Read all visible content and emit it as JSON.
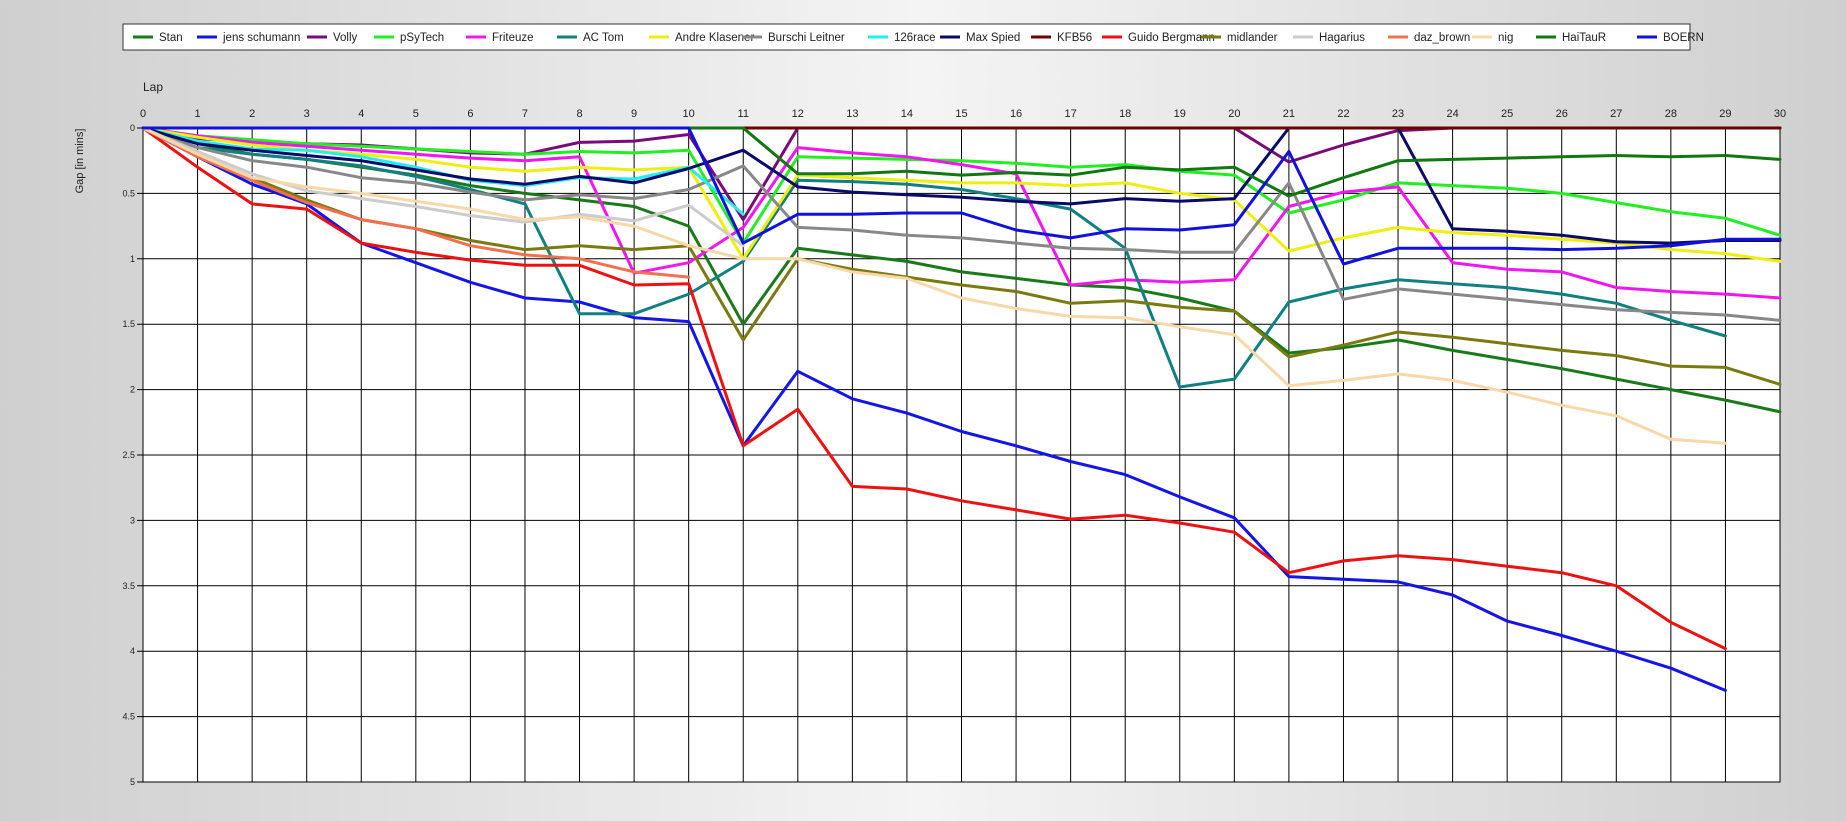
{
  "chart_data": {
    "type": "line",
    "xlabel": "Lap",
    "ylabel": "Gap [in mins]",
    "x": [
      0,
      1,
      2,
      3,
      4,
      5,
      6,
      7,
      8,
      9,
      10,
      11,
      12,
      13,
      14,
      15,
      16,
      17,
      18,
      19,
      20,
      21,
      22,
      23,
      24,
      25,
      26,
      27,
      28,
      29,
      30
    ],
    "xlim": [
      0,
      30
    ],
    "ylim": [
      0,
      5
    ],
    "y_inverted": true,
    "y_ticks": [
      "0",
      "0.5",
      "1",
      "1.5",
      "2",
      "2.5",
      "3",
      "3.5",
      "4",
      "4.5",
      "5"
    ],
    "grid": true,
    "legend_position": "top",
    "series": [
      {
        "name": "Stan",
        "color": "#1a7a1a",
        "values": [
          0,
          0.12,
          0.2,
          0.24,
          0.3,
          0.36,
          0.44,
          0.5,
          0.55,
          0.6,
          0.75,
          1.5,
          0.92,
          0.97,
          1.02,
          1.1,
          1.15,
          1.2,
          1.22,
          1.3,
          1.4,
          1.72,
          1.68,
          1.62,
          1.7,
          1.77,
          1.84,
          1.92,
          2.0,
          2.08,
          2.17
        ]
      },
      {
        "name": "jens  schumann",
        "color": "#1515e8",
        "values": [
          0,
          0.22,
          0.43,
          0.58,
          0.88,
          1.03,
          1.18,
          1.3,
          1.33,
          1.45,
          1.48,
          2.43,
          1.86,
          2.07,
          2.18,
          2.32,
          2.43,
          2.55,
          2.65,
          2.82,
          2.98,
          3.43,
          3.45,
          3.47,
          3.57,
          3.77,
          3.88,
          4.0,
          4.13,
          4.3,
          null
        ]
      },
      {
        "name": "Volly",
        "color": "#7a0a7a",
        "values": [
          0,
          0.08,
          0.11,
          0.12,
          0.13,
          0.16,
          0.19,
          0.2,
          0.11,
          0.1,
          0.05,
          0.7,
          0,
          0,
          0,
          0,
          0,
          0,
          0,
          0,
          0,
          0.26,
          0.13,
          0.02,
          0,
          0,
          0,
          0,
          0,
          0,
          0
        ]
      },
      {
        "name": "pSyTech",
        "color": "#22ee22",
        "values": [
          0,
          0.06,
          0.09,
          0.12,
          0.14,
          0.16,
          0.18,
          0.2,
          0.18,
          0.19,
          0.17,
          0.88,
          0.22,
          0.23,
          0.24,
          0.25,
          0.27,
          0.3,
          0.28,
          0.33,
          0.36,
          0.65,
          0.55,
          0.42,
          0.44,
          0.46,
          0.5,
          0.57,
          0.64,
          0.69,
          0.82
        ]
      },
      {
        "name": "Friteuze",
        "color": "#ee18ee",
        "values": [
          0,
          0.06,
          0.11,
          0.14,
          0.17,
          0.2,
          0.23,
          0.25,
          0.22,
          1.11,
          1.03,
          0.76,
          0.15,
          0.19,
          0.22,
          0.28,
          0.35,
          1.2,
          1.16,
          1.18,
          1.16,
          0.6,
          0.49,
          0.45,
          1.03,
          1.08,
          1.1,
          1.22,
          1.25,
          1.27,
          1.3
        ]
      },
      {
        "name": "AC Tom",
        "color": "#118080",
        "values": [
          0,
          0.15,
          0.2,
          0.24,
          0.29,
          0.37,
          0.47,
          0.58,
          1.42,
          1.42,
          1.27,
          1.02,
          0.4,
          0.41,
          0.43,
          0.47,
          0.54,
          0.62,
          0.92,
          1.98,
          1.92,
          1.33,
          1.23,
          1.16,
          1.19,
          1.22,
          1.27,
          1.34,
          1.47,
          1.59,
          null
        ]
      },
      {
        "name": "Andre Klasener",
        "color": "#eeee11",
        "values": [
          0,
          0.07,
          0.13,
          0.17,
          0.2,
          0.24,
          0.3,
          0.33,
          0.3,
          0.32,
          0.3,
          1.0,
          0.36,
          0.38,
          0.4,
          0.42,
          0.42,
          0.44,
          0.42,
          0.5,
          0.55,
          0.94,
          0.84,
          0.76,
          0.8,
          0.82,
          0.85,
          0.88,
          0.93,
          0.96,
          1.02
        ]
      },
      {
        "name": "Burschi Leitner",
        "color": "#888888",
        "values": [
          0,
          0.15,
          0.25,
          0.3,
          0.38,
          0.42,
          0.49,
          0.55,
          0.51,
          0.54,
          0.47,
          0.29,
          0.76,
          0.78,
          0.82,
          0.84,
          0.88,
          0.92,
          0.93,
          0.95,
          0.95,
          0.42,
          1.31,
          1.23,
          1.27,
          1.31,
          1.35,
          1.39,
          1.41,
          1.43,
          1.47
        ]
      },
      {
        "name": "126race",
        "color": "#22eeee",
        "values": [
          0,
          0.1,
          0.16,
          0.17,
          0.22,
          0.3,
          0.4,
          0.44,
          0.38,
          0.39,
          0.3,
          0.66,
          null,
          null,
          null,
          null,
          null,
          null,
          null,
          null,
          null,
          null,
          null,
          null,
          null,
          null,
          null,
          null,
          null,
          null,
          null
        ]
      },
      {
        "name": "Max Spied",
        "color": "#0a0a6a",
        "values": [
          0,
          0.12,
          0.17,
          0.21,
          0.25,
          0.32,
          0.39,
          0.43,
          0.37,
          0.42,
          0.31,
          0.17,
          0.45,
          0.49,
          0.51,
          0.53,
          0.56,
          0.58,
          0.54,
          0.56,
          0.54,
          0,
          0,
          0,
          0.77,
          0.79,
          0.82,
          0.87,
          0.88,
          0.86,
          0.86
        ]
      },
      {
        "name": "KFB56",
        "color": "#700000",
        "values": [
          0,
          0,
          0,
          0,
          0,
          0,
          0,
          0,
          0,
          0,
          0,
          0,
          0,
          0,
          0,
          0,
          0,
          0,
          0,
          0,
          0,
          0,
          0,
          0,
          0,
          0,
          0,
          0,
          0,
          0,
          0
        ]
      },
      {
        "name": "Guido Bergmann",
        "color": "#ee1111",
        "values": [
          0,
          0.3,
          0.58,
          0.62,
          0.88,
          0.95,
          1.01,
          1.05,
          1.05,
          1.2,
          1.19,
          2.43,
          2.15,
          2.74,
          2.76,
          2.85,
          2.92,
          2.99,
          2.96,
          3.02,
          3.09,
          3.4,
          3.31,
          3.27,
          3.3,
          3.35,
          3.4,
          3.5,
          3.78,
          3.98,
          null
        ]
      },
      {
        "name": "midlander",
        "color": "#7a7a10",
        "values": [
          0,
          0.2,
          0.38,
          0.55,
          0.7,
          0.77,
          0.86,
          0.93,
          0.9,
          0.93,
          0.9,
          1.62,
          1.0,
          1.08,
          1.14,
          1.2,
          1.25,
          1.34,
          1.32,
          1.37,
          1.4,
          1.75,
          1.66,
          1.56,
          1.6,
          1.65,
          1.7,
          1.74,
          1.82,
          1.83,
          1.96
        ]
      },
      {
        "name": "Hagarius",
        "color": "#cccccc",
        "values": [
          0,
          0.18,
          0.35,
          0.48,
          0.54,
          0.6,
          0.67,
          0.72,
          0.66,
          0.71,
          0.59,
          0.9,
          null,
          null,
          null,
          null,
          null,
          null,
          null,
          null,
          null,
          null,
          null,
          null,
          null,
          null,
          null,
          null,
          null,
          null,
          null
        ]
      },
      {
        "name": "daz_brown",
        "color": "#f07050",
        "values": [
          0,
          0.22,
          0.4,
          0.57,
          0.7,
          0.77,
          0.9,
          0.97,
          1.0,
          1.1,
          1.14,
          null,
          null,
          null,
          null,
          null,
          null,
          null,
          null,
          null,
          null,
          null,
          null,
          null,
          null,
          null,
          null,
          null,
          null,
          null,
          null
        ]
      },
      {
        "name": "nig",
        "color": "#f8d8a8",
        "values": [
          0,
          0.2,
          0.38,
          0.45,
          0.5,
          0.56,
          0.62,
          0.7,
          0.68,
          0.75,
          0.9,
          1.0,
          1.0,
          1.1,
          1.15,
          1.3,
          1.38,
          1.44,
          1.45,
          1.52,
          1.58,
          1.97,
          1.93,
          1.88,
          1.93,
          2.02,
          2.12,
          2.2,
          2.38,
          2.41,
          null
        ]
      },
      {
        "name": "HaiTauR",
        "color": "#117711",
        "values": [
          0,
          0,
          0,
          0,
          0,
          0,
          0,
          0,
          0,
          0,
          0,
          0,
          0.35,
          0.35,
          0.33,
          0.36,
          0.34,
          0.36,
          0.3,
          0.32,
          0.3,
          0.52,
          0.38,
          0.25,
          0.24,
          0.23,
          0.22,
          0.21,
          0.22,
          0.21,
          0.24
        ]
      },
      {
        "name": "BOERN",
        "color": "#1111dd",
        "values": [
          0,
          0,
          0,
          0,
          0,
          0,
          0,
          0,
          0,
          0,
          0,
          0.88,
          0.66,
          0.66,
          0.65,
          0.65,
          0.78,
          0.84,
          0.77,
          0.78,
          0.74,
          0.18,
          1.04,
          0.92,
          0.92,
          0.92,
          0.93,
          0.92,
          0.9,
          0.85,
          0.85
        ]
      }
    ]
  }
}
